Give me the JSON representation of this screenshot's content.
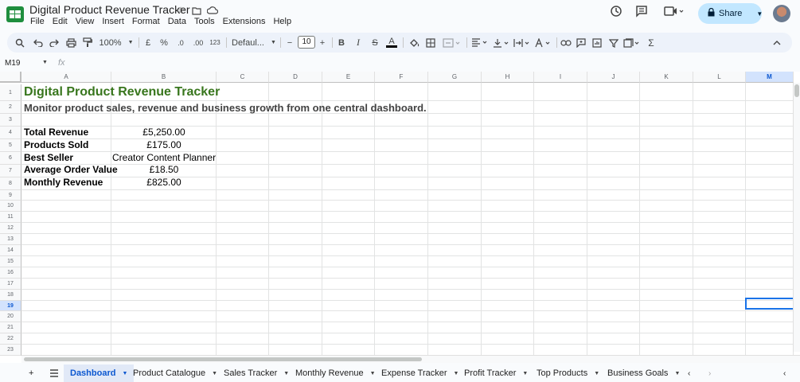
{
  "doc": {
    "title": "Digital Product Revenue Tracker"
  },
  "menu": [
    "File",
    "Edit",
    "View",
    "Insert",
    "Format",
    "Data",
    "Tools",
    "Extensions",
    "Help"
  ],
  "share": {
    "label": "Share"
  },
  "toolbar": {
    "zoom": "100%",
    "currency": "£",
    "percent": "%",
    "dec_decrease": ".0",
    "dec_increase": ".00",
    "number_format": "123",
    "font": "Defaul...",
    "font_size": "10",
    "bold": "B",
    "italic": "I",
    "strike": "S",
    "text_color": "A",
    "sigma": "Σ"
  },
  "formula_bar": {
    "name_box": "M19",
    "fx": "fx"
  },
  "columns": [
    "A",
    "B",
    "C",
    "D",
    "E",
    "F",
    "G",
    "H",
    "I",
    "J",
    "K",
    "L",
    "M"
  ],
  "active_column": "M",
  "rows": [
    "1",
    "2",
    "3",
    "4",
    "5",
    "6",
    "7",
    "8",
    "9",
    "10",
    "11",
    "12",
    "13",
    "14",
    "15",
    "16",
    "17",
    "18",
    "19",
    "20",
    "21",
    "22",
    "23"
  ],
  "active_row": "19",
  "sheet": {
    "title": "Digital Product Revenue Tracker",
    "subtitle": "Monitor product sales, revenue and business growth from one central dashboard.",
    "metrics": [
      {
        "label": "Total Revenue",
        "value": "£5,250.00"
      },
      {
        "label": "Products Sold",
        "value": "£175.00"
      },
      {
        "label": "Best Seller",
        "value": "Creator Content Planner"
      },
      {
        "label": "Average Order Value",
        "value": "£18.50"
      },
      {
        "label": "Monthly Revenue",
        "value": "£825.00"
      }
    ]
  },
  "tabs": [
    {
      "label": "Dashboard",
      "active": true
    },
    {
      "label": "Product Catalogue",
      "active": false
    },
    {
      "label": "Sales Tracker",
      "active": false
    },
    {
      "label": "Monthly Revenue",
      "active": false
    },
    {
      "label": "Expense Tracker",
      "active": false
    },
    {
      "label": "Profit Tracker",
      "active": false
    },
    {
      "label": "Top Products",
      "active": false
    },
    {
      "label": "Business Goals",
      "active": false
    }
  ],
  "colors": {
    "title_green": "#38761d",
    "selection_blue": "#1a73e8",
    "share_bg": "#c2e7ff"
  }
}
